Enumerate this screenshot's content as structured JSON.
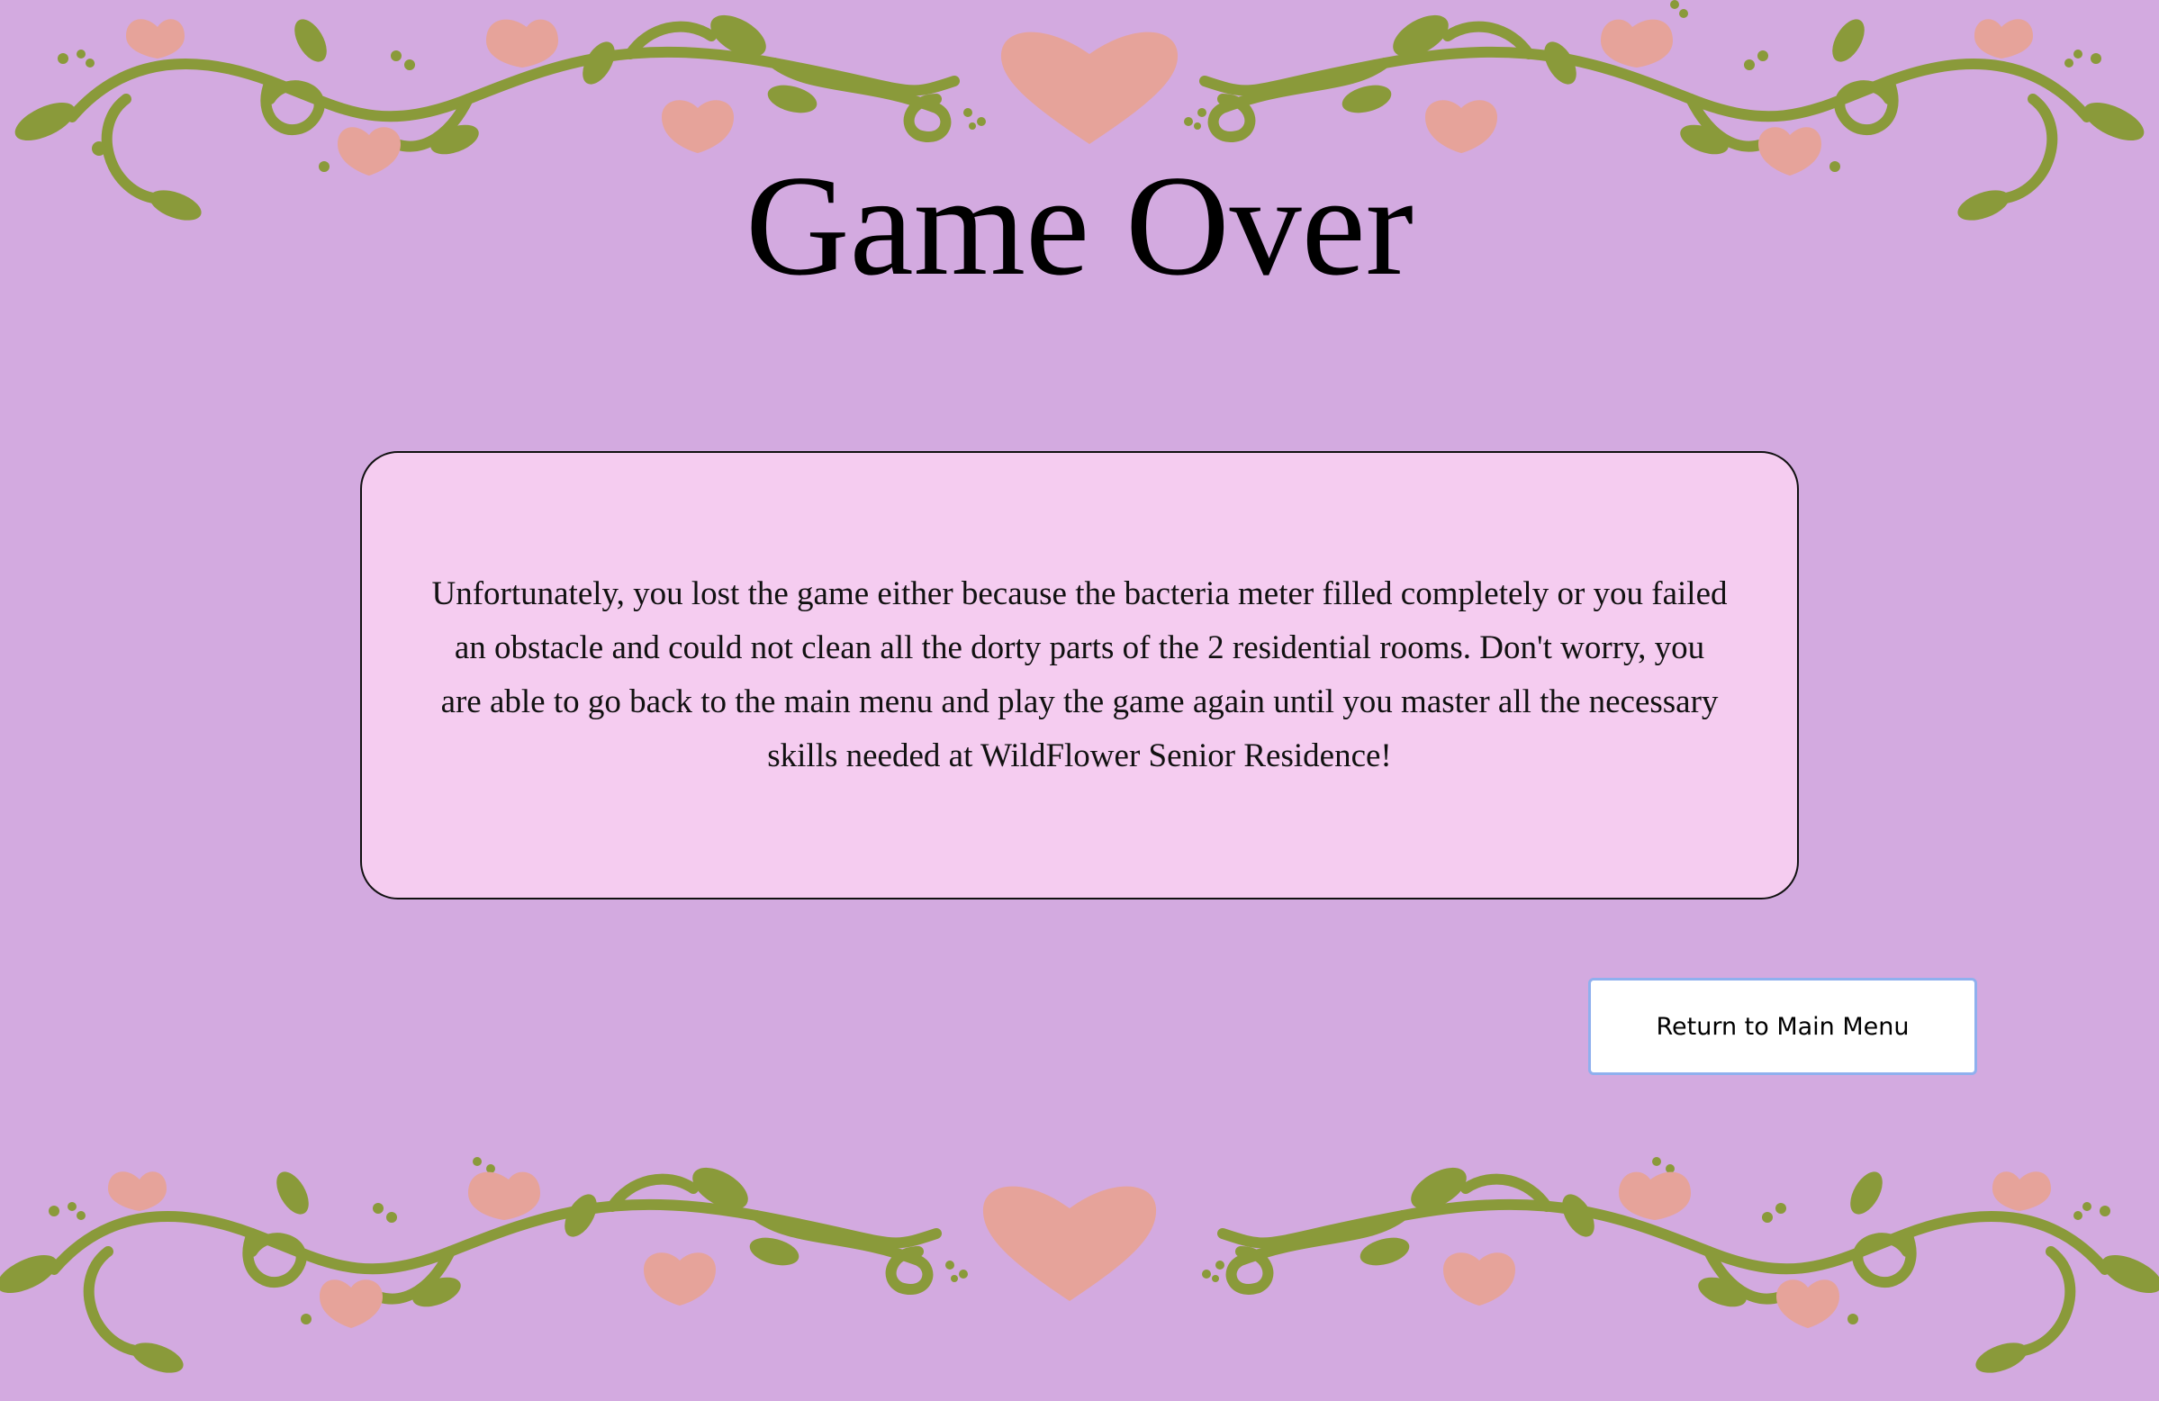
{
  "screen": {
    "title": "Game Over",
    "message": "Unfortunately, you lost the game either because the bacteria meter filled completely or you failed an obstacle and could not clean all the dorty parts of the 2 residential rooms. Don't worry, you are able to go back to the main menu and play the game again until you master all the necessary skills needed at WildFlower Senior Residence!",
    "button_label": "Return to Main Menu"
  },
  "colors": {
    "background": "#d3aae0",
    "message_box": "#f5ccf0",
    "vine": "#8a9a3a",
    "flower": "#e6a39a",
    "button_border": "#8fb0ee"
  },
  "decorations": {
    "top_border": "floral-vine-border-with-heart",
    "bottom_border": "floral-vine-border-with-heart"
  }
}
